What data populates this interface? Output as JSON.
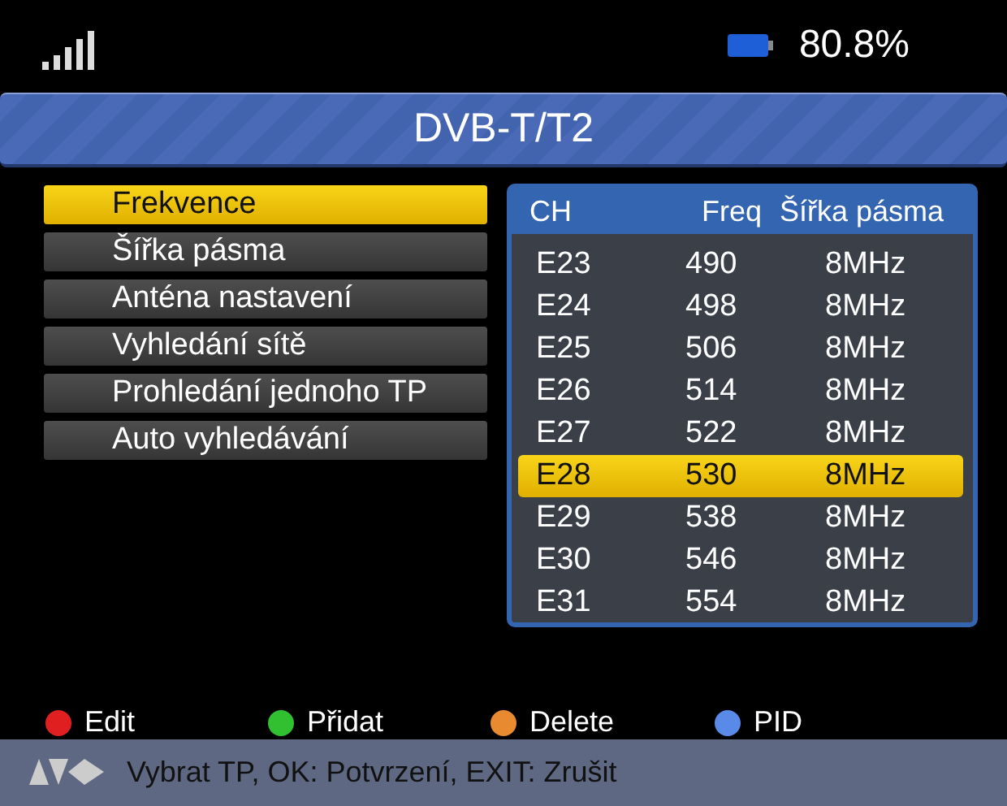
{
  "status_bar": {
    "battery": "80.8%"
  },
  "window": {
    "title": "DVB-T/T2"
  },
  "menu": [
    {
      "label": "Frekvence",
      "selected": true
    },
    {
      "label": "Šířka pásma",
      "selected": false
    },
    {
      "label": "Anténa nastavení",
      "selected": false
    },
    {
      "label": "Vyhledání sítě",
      "selected": false
    },
    {
      "label": "Prohledání jednoho TP",
      "selected": false
    },
    {
      "label": "Auto vyhledávání",
      "selected": false
    }
  ],
  "table": {
    "columns": [
      "CH",
      "Freq",
      "Šířka pásma"
    ],
    "rows": [
      {
        "cells": [
          "E23",
          "490",
          "8MHz"
        ],
        "selected": false
      },
      {
        "cells": [
          "E24",
          "498",
          "8MHz"
        ],
        "selected": false
      },
      {
        "cells": [
          "E25",
          "506",
          "8MHz"
        ],
        "selected": false
      },
      {
        "cells": [
          "E26",
          "514",
          "8MHz"
        ],
        "selected": false
      },
      {
        "cells": [
          "E27",
          "522",
          "8MHz"
        ],
        "selected": false
      },
      {
        "cells": [
          "E28",
          "530",
          "8MHz"
        ],
        "selected": true
      },
      {
        "cells": [
          "E29",
          "538",
          "8MHz"
        ],
        "selected": false
      },
      {
        "cells": [
          "E30",
          "546",
          "8MHz"
        ],
        "selected": false
      },
      {
        "cells": [
          "E31",
          "554",
          "8MHz"
        ],
        "selected": false
      }
    ]
  },
  "legend": [
    {
      "label": "Edit",
      "color": "#e02020"
    },
    {
      "label": "Přidat",
      "color": "#30c030"
    },
    {
      "label": "Delete",
      "color": "#e88a30"
    },
    {
      "label": "PID",
      "color": "#5a8ae8"
    }
  ],
  "help_bar": {
    "text": "Vybrat TP, OK: Potvrzení, EXIT: Zrušit"
  }
}
